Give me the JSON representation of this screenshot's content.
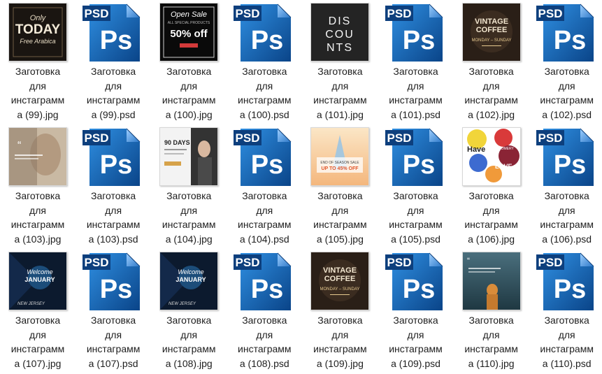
{
  "icons": {
    "jpg": "image-thumbnail-icon",
    "psd": "photoshop-psd-file-icon"
  },
  "psd_badge": "PSD",
  "psd_logo": "Ps",
  "colors": {
    "psd_dark": "#0a4a8c",
    "psd_light": "#2e8fe0",
    "label_text": "#1e1e1e"
  },
  "files": [
    {
      "type": "jpg",
      "lines": [
        "Заготовка",
        "для",
        "инстаграмм",
        "а (99).jpg"
      ],
      "thumb_text": [
        "Only",
        "TODAY",
        "Free Arabica"
      ]
    },
    {
      "type": "psd",
      "lines": [
        "Заготовка",
        "для",
        "инстаграмм",
        "а (99).psd"
      ]
    },
    {
      "type": "jpg",
      "lines": [
        "Заготовка",
        "для",
        "инстаграмм",
        "а (100).jpg"
      ],
      "thumb_text": [
        "Open Sale",
        "ALL SPECIAL PRODUCTS",
        "50% off"
      ]
    },
    {
      "type": "psd",
      "lines": [
        "Заготовка",
        "для",
        "инстаграмм",
        "а (100).psd"
      ]
    },
    {
      "type": "jpg",
      "lines": [
        "Заготовка",
        "для",
        "инстаграмм",
        "а (101).jpg"
      ],
      "thumb_text": [
        "DIS",
        "COU",
        "NTS"
      ]
    },
    {
      "type": "psd",
      "lines": [
        "Заготовка",
        "для",
        "инстаграмм",
        "а (101).psd"
      ]
    },
    {
      "type": "jpg",
      "lines": [
        "Заготовка",
        "для",
        "инстаграмм",
        "а (102).jpg"
      ],
      "thumb_text": [
        "VINTAGE",
        "COFFEE",
        "MONDAY – SUNDAY"
      ]
    },
    {
      "type": "psd",
      "lines": [
        "Заготовка",
        "для",
        "инстаграмм",
        "а (102).psd"
      ]
    },
    {
      "type": "jpg",
      "lines": [
        "Заготовка",
        "для",
        "инстаграмм",
        "а (103).jpg"
      ],
      "thumb_text": [
        "“"
      ]
    },
    {
      "type": "psd",
      "lines": [
        "Заготовка",
        "для",
        "инстаграмм",
        "а (103).psd"
      ]
    },
    {
      "type": "jpg",
      "lines": [
        "Заготовка",
        "для",
        "инстаграмм",
        "а (104).jpg"
      ],
      "thumb_text": [
        "90 DAYS"
      ]
    },
    {
      "type": "psd",
      "lines": [
        "Заготовка",
        "для",
        "инстаграмм",
        "а (104).psd"
      ]
    },
    {
      "type": "jpg",
      "lines": [
        "Заготовка",
        "для",
        "инстаграмм",
        "а (105).jpg"
      ],
      "thumb_text": [
        "END OF SEASON SALE",
        "UP TO 45% OFF"
      ]
    },
    {
      "type": "psd",
      "lines": [
        "Заготовка",
        "для",
        "инстаграмм",
        "а (105).psd"
      ]
    },
    {
      "type": "jpg",
      "lines": [
        "Заготовка",
        "для",
        "инстаграмм",
        "а (106).jpg"
      ],
      "thumb_text": [
        "Have",
        "MONTGOMERY",
        "LOVE"
      ]
    },
    {
      "type": "psd",
      "lines": [
        "Заготовка",
        "для",
        "инстаграмм",
        "а (106).psd"
      ]
    },
    {
      "type": "jpg",
      "lines": [
        "Заготовка",
        "для",
        "инстаграмм",
        "а (107).jpg"
      ],
      "thumb_text": [
        "Welcome",
        "JANUARY",
        "NEW JERSEY"
      ]
    },
    {
      "type": "psd",
      "lines": [
        "Заготовка",
        "для",
        "инстаграмм",
        "а (107).psd"
      ]
    },
    {
      "type": "jpg",
      "lines": [
        "Заготовка",
        "для",
        "инстаграмм",
        "а (108).jpg"
      ],
      "thumb_text": [
        "Welcome",
        "JANUARY",
        "NEW JERSEY"
      ]
    },
    {
      "type": "psd",
      "lines": [
        "Заготовка",
        "для",
        "инстаграмм",
        "а (108).psd"
      ]
    },
    {
      "type": "jpg",
      "lines": [
        "Заготовка",
        "для",
        "инстаграмм",
        "а (109).jpg"
      ],
      "thumb_text": [
        "VINTAGE",
        "COFFEE",
        "MONDAY – SUNDAY"
      ]
    },
    {
      "type": "psd",
      "lines": [
        "Заготовка",
        "для",
        "инстаграмм",
        "а (109).psd"
      ]
    },
    {
      "type": "jpg",
      "lines": [
        "Заготовка",
        "для",
        "инстаграмм",
        "а (110).jpg"
      ],
      "thumb_text": [
        "“"
      ]
    },
    {
      "type": "psd",
      "lines": [
        "Заготовка",
        "для",
        "инстаграмм",
        "а (110).psd"
      ]
    }
  ]
}
